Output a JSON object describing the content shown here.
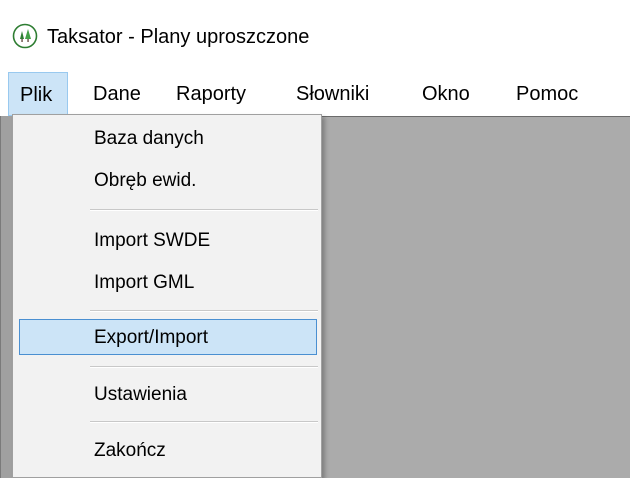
{
  "window": {
    "title": "Taksator - Plany uproszczone",
    "icon": "tree-app-icon"
  },
  "menubar": {
    "items": [
      {
        "label": "Plik",
        "active": true
      },
      {
        "label": "Dane"
      },
      {
        "label": "Raporty"
      },
      {
        "label": "Słowniki"
      },
      {
        "label": "Okno"
      },
      {
        "label": "Pomoc"
      }
    ]
  },
  "dropdown": {
    "items": [
      {
        "label": "Baza danych"
      },
      {
        "label": "Obręb ewid."
      },
      {
        "label": "Import SWDE"
      },
      {
        "label": "Import GML"
      },
      {
        "label": "Export/Import",
        "highlighted": true
      },
      {
        "label": "Ustawienia"
      },
      {
        "label": "Zakończ"
      }
    ]
  },
  "colors": {
    "highlight_bg": "#cce4f7",
    "highlight_border": "#4a8fd1",
    "client_bg": "#ababab",
    "menu_bg": "#f2f2f2"
  }
}
